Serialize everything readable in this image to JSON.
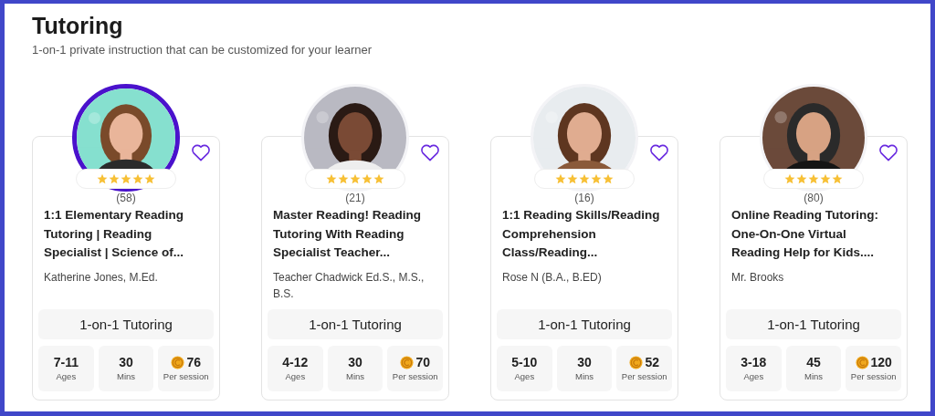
{
  "header": {
    "title": "Tutoring",
    "subtitle": "1-on-1 private instruction that can be customized for your learner"
  },
  "cards": [
    {
      "featured": true,
      "favorite": false,
      "stars": 5,
      "review_count": "(58)",
      "title": "1:1 Elementary Reading Tutoring | Reading Specialist | Science of...",
      "teacher": "Katherine Jones, M.Ed.",
      "format": "1-on-1 Tutoring",
      "stats": [
        {
          "value": "7-11",
          "label": "Ages",
          "kind": "plain"
        },
        {
          "value": "30",
          "label": "Mins",
          "kind": "plain"
        },
        {
          "value": "76",
          "label": "Per session",
          "kind": "coins"
        }
      ]
    },
    {
      "featured": false,
      "favorite": false,
      "stars": 5,
      "review_count": "(21)",
      "title": "Master Reading! Reading Tutoring With Reading Specialist Teacher...",
      "teacher": "Teacher Chadwick Ed.S., M.S., B.S.",
      "format": "1-on-1 Tutoring",
      "stats": [
        {
          "value": "4-12",
          "label": "Ages",
          "kind": "plain"
        },
        {
          "value": "30",
          "label": "Mins",
          "kind": "plain"
        },
        {
          "value": "70",
          "label": "Per session",
          "kind": "coins"
        }
      ]
    },
    {
      "featured": false,
      "favorite": false,
      "stars": 5,
      "review_count": "(16)",
      "title": "1:1 Reading Skills/Reading Comprehension Class/Reading...",
      "teacher": "Rose N (B.A., B.ED)",
      "format": "1-on-1 Tutoring",
      "stats": [
        {
          "value": "5-10",
          "label": "Ages",
          "kind": "plain"
        },
        {
          "value": "30",
          "label": "Mins",
          "kind": "plain"
        },
        {
          "value": "52",
          "label": "Per session",
          "kind": "coins"
        }
      ]
    },
    {
      "featured": false,
      "favorite": false,
      "stars": 5,
      "review_count": "(80)",
      "title": "Online Reading Tutoring: One-On-One Virtual Reading Help for Kids....",
      "teacher": "Mr. Brooks",
      "format": "1-on-1 Tutoring",
      "stats": [
        {
          "value": "3-18",
          "label": "Ages",
          "kind": "plain"
        },
        {
          "value": "45",
          "label": "Mins",
          "kind": "plain"
        },
        {
          "value": "120",
          "label": "Per session",
          "kind": "coins"
        }
      ]
    }
  ]
}
